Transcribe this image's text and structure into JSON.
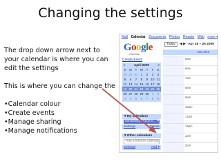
{
  "slide": {
    "title": "Changing the settings",
    "para1": "The drop down arrow next to your calendar is where you can edit the settings",
    "para2": "This is where you can change the",
    "bullets": [
      "Calendar colour",
      "Create events",
      "Manage sharing",
      "Manage notifications"
    ]
  },
  "screenshot": {
    "nav": [
      "Mail",
      "Calendar",
      "Documents",
      "Photos",
      "Reader",
      "Web",
      "more ▾"
    ],
    "active_nav": "Calendar",
    "logo_text": "Google",
    "logo_sub": "Calendar",
    "create_event": "Create Event",
    "toolbar": {
      "today": "Today",
      "range": "Apr 19 – 25 2009"
    },
    "day_header": "Sat 4/19",
    "mini_calendar": {
      "prev": "«",
      "month": "April 2009",
      "next": "»",
      "dow": [
        "S",
        "M",
        "T",
        "W",
        "T",
        "F",
        "S"
      ],
      "weeks": [
        [
          "29",
          "30",
          "31",
          "1",
          "2",
          "3",
          "4"
        ],
        [
          "5",
          "6",
          "7",
          "8",
          "9",
          "10",
          "11"
        ],
        [
          "12",
          "13",
          "14",
          "15",
          "16",
          "17",
          "18"
        ],
        [
          "19",
          "20",
          "21",
          "22",
          "23",
          "24",
          "25"
        ],
        [
          "26",
          "27",
          "28",
          "29",
          "30",
          "1",
          "2"
        ],
        [
          "3",
          "4",
          "5",
          "6",
          "7",
          "8",
          "9"
        ]
      ]
    },
    "my_calendars": {
      "header": "▾ My calendars",
      "item": "sandra@gw-tt.co.n...",
      "dropdown": "▾",
      "settings": "Settings",
      "create": "Create"
    },
    "other_calendars": {
      "header": "▾ Other calendars",
      "placeholder": "Add a friend's calendar",
      "settings": "Settings",
      "add": "Add ▾"
    },
    "hours": [
      "5am",
      "6am",
      "7am",
      "8am",
      "9am",
      "10am",
      "11am",
      "12pm",
      "1pm",
      "2pm"
    ],
    "colors": {
      "panel": "#c3d9ff",
      "calendar_item": "#5a6fd0",
      "arrow": "#c0504d"
    }
  }
}
